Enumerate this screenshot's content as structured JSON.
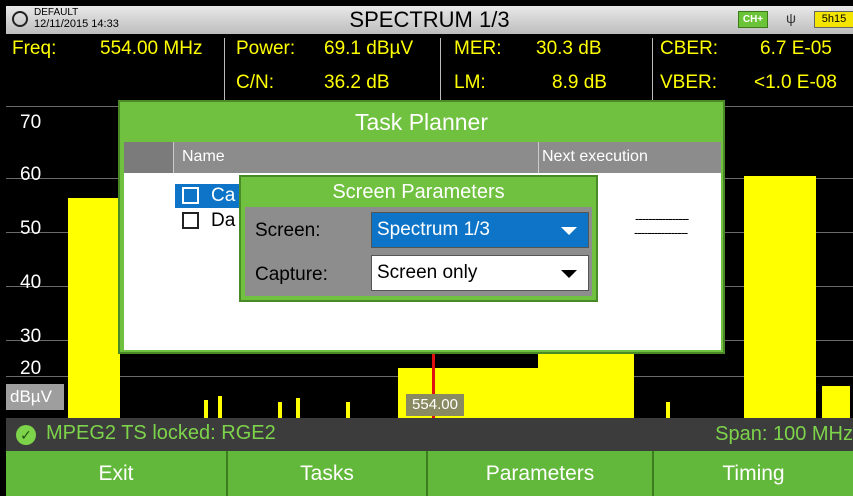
{
  "header": {
    "profile": "DEFAULT",
    "datetime": "12/11/2015 14:33",
    "title": "SPECTRUM 1/3",
    "channel_badge": "CH+",
    "battery": "5h15"
  },
  "measurements": {
    "freq_label": "Freq:",
    "freq_value": "554.00 MHz",
    "power_label": "Power:",
    "power_value": "69.1 dBµV",
    "cn_label": "C/N:",
    "cn_value": "36.2 dB",
    "mer_label": "MER:",
    "mer_value": "30.3 dB",
    "lm_label": "LM:",
    "lm_value": "8.9 dB",
    "cber_label": "CBER:",
    "cber_value": "6.7 E-05",
    "vber_label": "VBER:",
    "vber_value": "<1.0 E-08"
  },
  "plot": {
    "y_ticks": [
      "70",
      "60",
      "50",
      "40",
      "30",
      "20"
    ],
    "unit": "dBµV",
    "marker_label": "554.00"
  },
  "status": {
    "lock_text": "MPEG2 TS locked: RGE2",
    "span_text": "Span: 100 MHz"
  },
  "bottom_bar": {
    "tabs": [
      "Exit",
      "Tasks",
      "Parameters",
      "Timing"
    ]
  },
  "task_planner": {
    "title": "Task Planner",
    "col_name": "Name",
    "col_next": "Next execution",
    "rows": [
      {
        "name": "Ca",
        "next": "----------------"
      },
      {
        "name": "Da",
        "next": "----------------"
      }
    ]
  },
  "screen_parameters": {
    "title": "Screen Parameters",
    "screen_label": "Screen:",
    "screen_value": "Spectrum 1/3",
    "capture_label": "Capture:",
    "capture_value": "Screen only"
  },
  "colors": {
    "trace": "#ffff00",
    "dialog_green": "#6fc13f",
    "selection_blue": "#0e74c8",
    "marker": "#e01010"
  }
}
